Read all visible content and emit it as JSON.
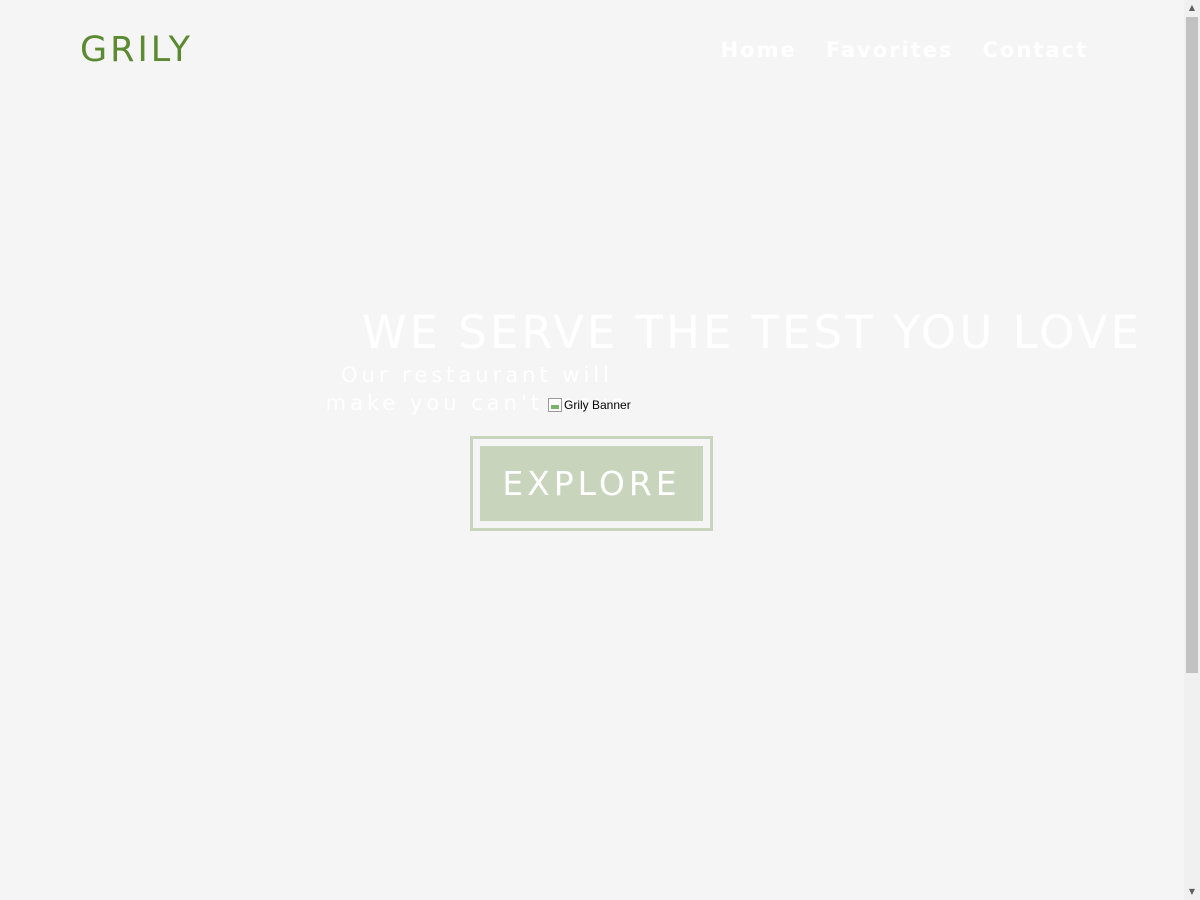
{
  "header": {
    "logo": "GRILY",
    "nav": [
      {
        "label": "Home"
      },
      {
        "label": "Favorites"
      },
      {
        "label": "Contact"
      }
    ]
  },
  "hero": {
    "title": "WE SERVE THE TEST YOU LOVE",
    "subtitle": "Our restaurant will make you can't move",
    "banner_alt": "Grily Banner",
    "explore_label": "EXPLORE"
  },
  "colors": {
    "brand_green": "#5b8a32",
    "button_green": "#c8d5bc",
    "background": "#f5f5f5"
  },
  "icons": {
    "scroll_up": "triangle-up-icon",
    "scroll_down": "triangle-down-icon",
    "broken_image": "broken-image-icon"
  }
}
